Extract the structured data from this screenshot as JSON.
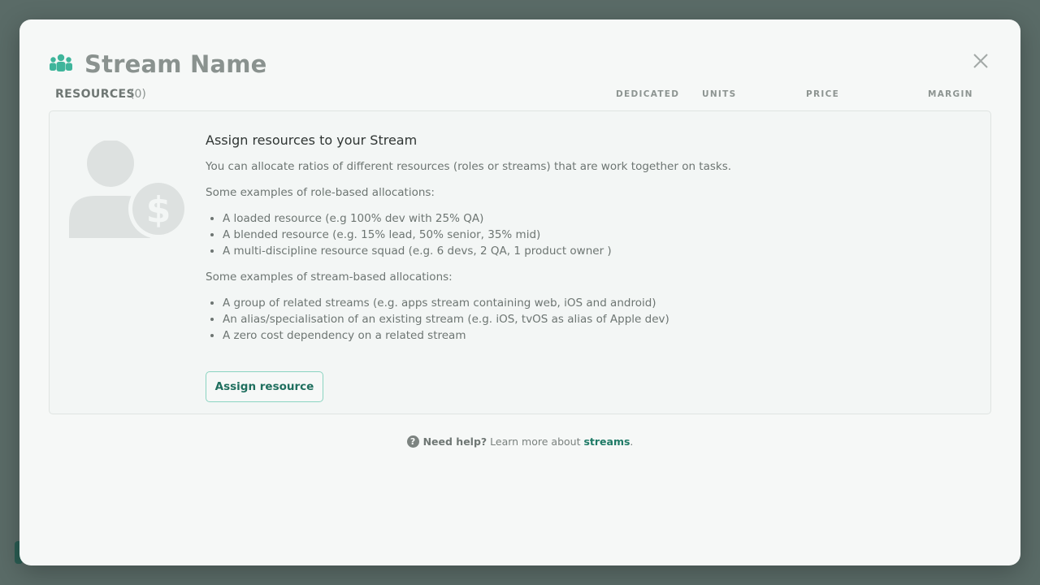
{
  "header": {
    "title": "Stream Name",
    "icon": "team-icon",
    "accent_color": "#3fb59b"
  },
  "close": {
    "icon": "close-icon"
  },
  "resources": {
    "label": "RESOURCES",
    "count": "(0)",
    "columns": [
      "DEDICATED",
      "UNITS",
      "PRICE",
      "MARGIN"
    ]
  },
  "empty_state": {
    "illustration": "user-dollar-icon",
    "heading": "Assign resources to your Stream",
    "intro": "You can allocate ratios of different resources (roles or streams) that are work together on tasks.",
    "role_heading": "Some examples of role-based allocations:",
    "role_items": [
      "A loaded resource (e.g 100% dev with 25% QA)",
      "A blended resource (e.g. 15% lead, 50% senior, 35% mid)",
      "A multi-discipline resource squad (e.g. 6 devs, 2 QA, 1 product owner )"
    ],
    "stream_heading": "Some examples of stream-based allocations:",
    "stream_items": [
      "A group of related streams (e.g. apps stream containing web, iOS and android)",
      "An alias/specialisation of an existing stream (e.g. iOS, tvOS as alias of Apple dev)",
      "A zero cost dependency on a related stream"
    ],
    "button_label": "Assign resource"
  },
  "help": {
    "icon": "question-icon",
    "strong": "Need help?",
    "text": "Learn more about",
    "link": "streams",
    "suffix": "."
  }
}
